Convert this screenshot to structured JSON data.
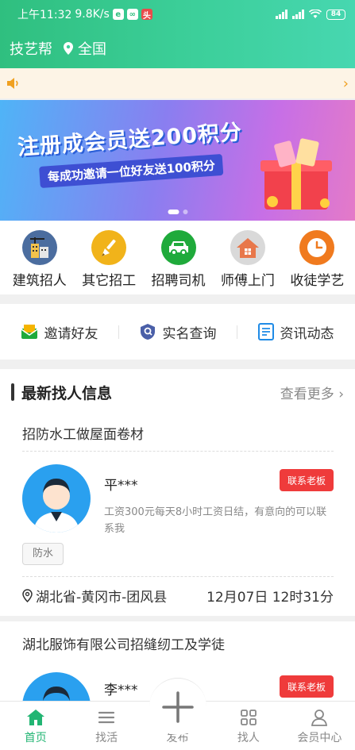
{
  "status_bar": {
    "time": "上午11:32",
    "speed": "9.8K/s",
    "battery": "84"
  },
  "header": {
    "app_name": "技艺帮",
    "location": "全国"
  },
  "banner": {
    "headline": "注册成会员送200积分",
    "subline": "每成功邀请一位好友送100积分"
  },
  "categories": [
    {
      "label": "建筑招人",
      "icon": "building-icon",
      "color": "#4b6d9f"
    },
    {
      "label": "其它招工",
      "icon": "brush-icon",
      "color": "#f1b31a"
    },
    {
      "label": "招聘司机",
      "icon": "car-icon",
      "color": "#1faa3b"
    },
    {
      "label": "师傅上门",
      "icon": "house-icon",
      "color": "#e8774a"
    },
    {
      "label": "收徒学艺",
      "icon": "clock-icon",
      "color": "#f07a1e"
    }
  ],
  "quick_links": [
    {
      "label": "邀请好友",
      "icon": "envelope-icon"
    },
    {
      "label": "实名查询",
      "icon": "id-badge-icon"
    },
    {
      "label": "资讯动态",
      "icon": "document-icon"
    }
  ],
  "list": {
    "heading": "最新找人信息",
    "more": "查看更多",
    "jobs": [
      {
        "title": "招防水工做屋面卷材",
        "user": "平***",
        "contact_label": "联系老板",
        "description": "工资300元每天8小时工资日结，有意向的可以联系我",
        "tag": "防水",
        "location": "湖北省-黄冈市-团风县",
        "time": "12月07日 12时31分"
      },
      {
        "title": "湖北服饰有限公司招缝纫工及学徒",
        "user": "李***",
        "contact_label": "联系老板"
      }
    ]
  },
  "tabbar": [
    {
      "label": "首页",
      "icon": "home-icon",
      "active": true
    },
    {
      "label": "找活",
      "icon": "menu-icon",
      "active": false
    },
    {
      "label": "发布",
      "icon": "plus-icon",
      "active": false
    },
    {
      "label": "找人",
      "icon": "grid-icon",
      "active": false
    },
    {
      "label": "会员中心",
      "icon": "user-icon",
      "active": false
    }
  ],
  "colors": {
    "brand": "#2fbf7f",
    "active_tab": "#22b573",
    "contact_button": "#ef3b3b"
  }
}
